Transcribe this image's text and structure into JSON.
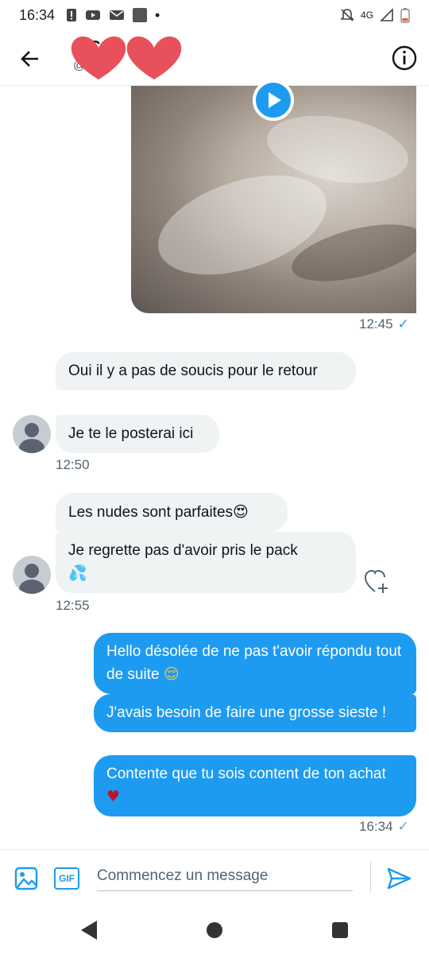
{
  "status_bar": {
    "time": "16:34",
    "network": "4G"
  },
  "header": {
    "name": "B C",
    "handle": "@ Cs"
  },
  "messages": [
    {
      "direction": "out",
      "type": "video",
      "time": "12:45",
      "status": "✓"
    },
    {
      "direction": "in",
      "text": "Oui il y a pas de soucis pour le retour"
    },
    {
      "direction": "in",
      "text": "Je te le posterai ici",
      "time": "12:50"
    },
    {
      "direction": "in",
      "text": "Les nudes sont parfaites",
      "emoji": "😍"
    },
    {
      "direction": "in",
      "text": "Je regrette pas d'avoir pris le pack",
      "emoji": "💦",
      "time": "12:55"
    },
    {
      "direction": "out",
      "text": "Hello désolée de ne pas t'avoir répondu tout de suite",
      "emoji": "😌"
    },
    {
      "direction": "out",
      "text": "J'avais besoin de faire une grosse sieste !"
    },
    {
      "direction": "out",
      "text": "Contente que tu sois content de ton achat",
      "emoji": "♥",
      "time": "16:34",
      "status": "✓"
    }
  ],
  "composer": {
    "placeholder": "Commencez un message",
    "gif_label": "GIF"
  },
  "icons": {
    "back": "arrow-left-icon",
    "info": "info-icon",
    "play": "play-icon",
    "like": "heart-plus-icon",
    "image": "image-icon",
    "gif": "gif-icon",
    "send": "send-icon"
  },
  "colors": {
    "accent": "#1d9bf0",
    "incoming": "#eff3f4",
    "text": "#0f1419",
    "muted": "#536471",
    "sticker": "#e8505b"
  }
}
